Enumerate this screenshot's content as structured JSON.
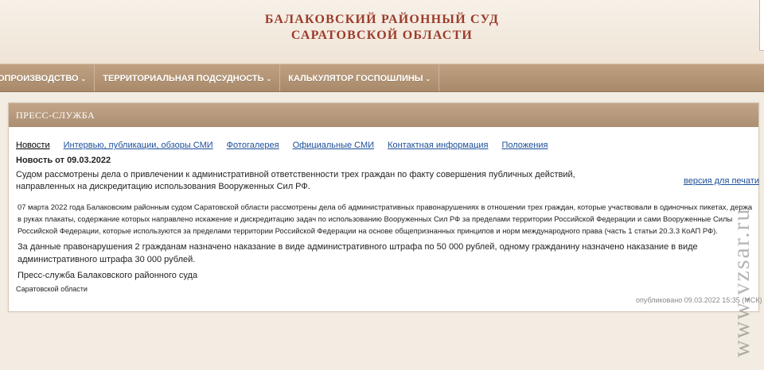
{
  "header": {
    "title_line1": "БАЛАКОВСКИЙ РАЙОННЫЙ СУД",
    "title_line2": "САРАТОВСКОЙ ОБЛАСТИ"
  },
  "nav": {
    "items": [
      {
        "label": "ОПРОИЗВОДСТВО"
      },
      {
        "label": "ТЕРРИТОРИАЛЬНАЯ ПОДСУДНОСТЬ"
      },
      {
        "label": "КАЛЬКУЛЯТОР ГОСПОШЛИНЫ"
      }
    ]
  },
  "panel": {
    "title": "ПРЕСС-СЛУЖБА",
    "tabs": [
      {
        "label": "Новости"
      },
      {
        "label": "Интервью, публикации, обзоры СМИ"
      },
      {
        "label": "Фотогалерея"
      },
      {
        "label": "Официальные СМИ"
      },
      {
        "label": "Контактная информация"
      },
      {
        "label": "Положения"
      }
    ],
    "news_date": "Новость от 09.03.2022",
    "lead": "Судом рассмотрены дела о привлечении к административной ответственности трех граждан по факту совершения публичных действий, направленных на дискредитацию использования Вооруженных Сил РФ.",
    "print_link": "версия для печати",
    "body": "07 марта 2022 года Балаковским районным судом Саратовской области рассмотрены дела об административных правонарушениях в отношении трех граждан, которые участвовали в одиночных пикетах, держа в руках плакаты, содержание которых направлено искажение и дискредитацию задач по использованию Вооруженных Сил РФ за пределами территории Российской Федерации и сами Вооруженные Силы Российской Федерации, которые используются за пределами территории Российской Федерации на основе общепризнанных принципов и норм международного права (часть 1 статьи 20.3.3 КоАП РФ).",
    "paragraph2": "За данные правонарушения 2 гражданам назначено наказание в виде административного штрафа по 50 000 рублей, одному гражданину назначено наказание в виде административного штрафа 30 000 рублей.",
    "signature": "Пресс-служба Балаковского районного суда",
    "signature_sub": "Саратовской области",
    "published": "опубликовано 09.03.2022 15:35 (МСК)"
  },
  "watermark": "www.vzsar.ru"
}
